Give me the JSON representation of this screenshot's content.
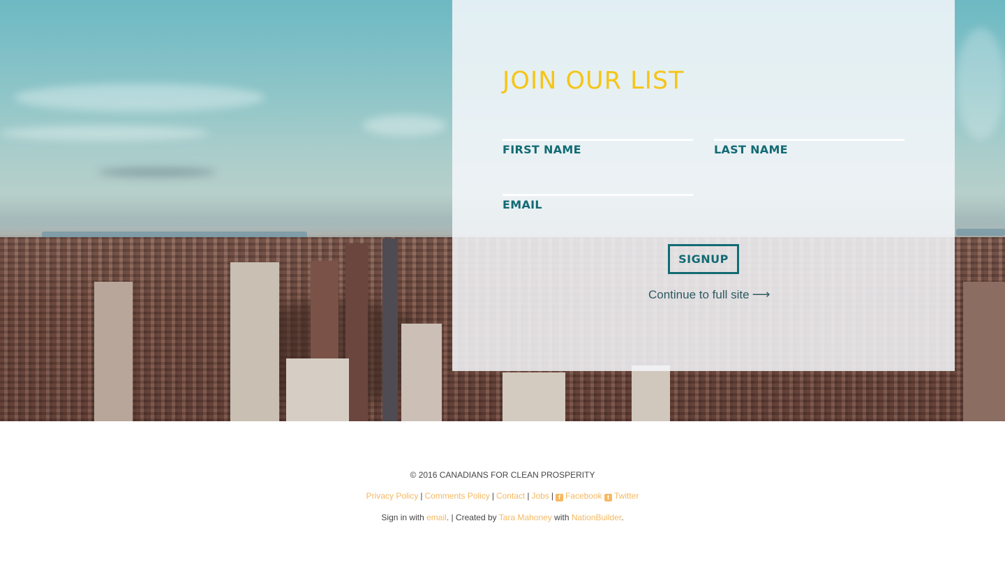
{
  "signup": {
    "title": "JOIN OUR LIST",
    "first_name_label": "FIRST NAME",
    "last_name_label": "LAST NAME",
    "email_label": "EMAIL",
    "first_name_value": "",
    "last_name_value": "",
    "email_value": "",
    "button_label": "SIGNUP",
    "continue_label": "Continue to full site",
    "continue_icon": "long-arrow-right-icon"
  },
  "footer": {
    "copyright": "© 2016 CANADIANS FOR CLEAN PROSPERITY",
    "links": {
      "privacy": "Privacy Policy",
      "comments": "Comments Policy",
      "contact": "Contact",
      "jobs": "Jobs",
      "facebook": "Facebook",
      "twitter": "Twitter",
      "sep": "|"
    },
    "signin_prefix": "Sign in with",
    "signin_link": "email",
    "created_text": ". | Created by",
    "creator": "Tara Mahoney",
    "with_text": "with",
    "platform": "NationBuilder",
    "end": "."
  },
  "colors": {
    "title_yellow": "#f5c518",
    "label_teal": "#126b73",
    "link_orange": "#f6b860"
  },
  "icons": {
    "facebook": "facebook-square-icon",
    "twitter": "twitter-square-icon"
  }
}
